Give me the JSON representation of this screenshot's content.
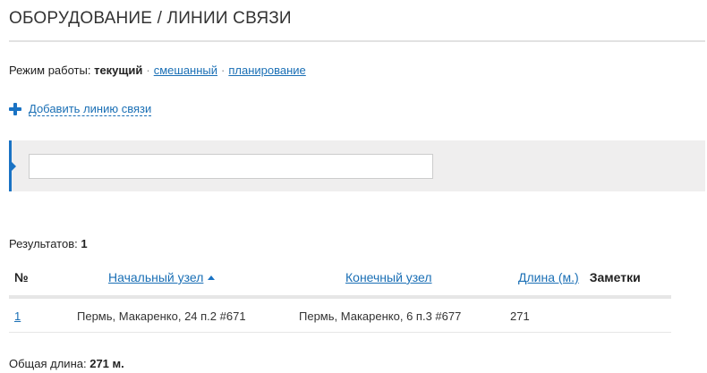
{
  "header": {
    "title": "ОБОРУДОВАНИЕ / ЛИНИИ СВЯЗИ"
  },
  "mode": {
    "label": "Режим работы:",
    "current": "текущий",
    "separator": "·",
    "options": [
      "смешанный",
      "планирование"
    ]
  },
  "actions": {
    "add_label": "Добавить линию связи"
  },
  "filter": {
    "value": "",
    "placeholder": ""
  },
  "results": {
    "label": "Результатов:",
    "count": "1",
    "columns": {
      "num": "№",
      "start_node": "Начальный узел",
      "end_node": "Конечный узел",
      "length": "Длина (м.)",
      "notes": "Заметки"
    },
    "rows": [
      {
        "num": "1",
        "start_node": "Пермь, Макаренко, 24 п.2 #671",
        "end_node": "Пермь, Макаренко, 6 п.3 #677",
        "length": "271",
        "notes": ""
      }
    ]
  },
  "summary": {
    "label": "Общая длина:",
    "value": "271 м."
  },
  "colors": {
    "accent": "#1a73c4",
    "link": "#1a6fb5",
    "panel": "#efeeee"
  }
}
